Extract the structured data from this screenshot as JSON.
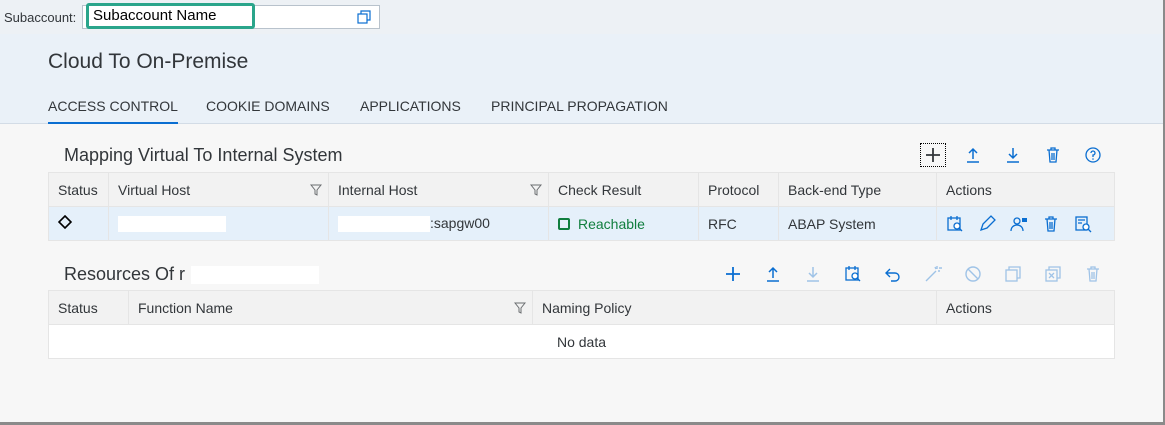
{
  "subaccount": {
    "label": "Subaccount:",
    "value": "Subaccount Name",
    "popout_icon": "popout-icon"
  },
  "page": {
    "title": "Cloud To On-Premise"
  },
  "tabs": [
    {
      "label": "ACCESS CONTROL",
      "active": true
    },
    {
      "label": "COOKIE DOMAINS",
      "active": false
    },
    {
      "label": "APPLICATIONS",
      "active": false
    },
    {
      "label": "PRINCIPAL PROPAGATION",
      "active": false
    }
  ],
  "mapping": {
    "title": "Mapping Virtual To Internal System",
    "toolbar": [
      "add-icon",
      "upload-icon",
      "download-icon",
      "delete-icon",
      "help-icon"
    ],
    "columns": [
      "Status",
      "Virtual Host",
      "Internal Host",
      "Check Result",
      "Protocol",
      "Back-end Type",
      "Actions"
    ],
    "rows": [
      {
        "status_icon": "diamond-icon",
        "virtual_host": "",
        "internal_host": ":sapgw00",
        "check_result": "Reachable",
        "protocol": "RFC",
        "backend_type": "ABAP System",
        "actions": [
          "check-availability-icon",
          "edit-icon",
          "principal-icon",
          "delete-icon",
          "resources-icon"
        ]
      }
    ]
  },
  "resources": {
    "title": "Resources Of r",
    "toolbar": [
      "add-icon",
      "upload-icon",
      "download-icon",
      "check-icon",
      "undo-icon",
      "wand-icon",
      "block-icon",
      "copy-icon",
      "remove-icon",
      "delete-icon"
    ],
    "columns": [
      "Status",
      "Function Name",
      "Naming Policy",
      "Actions"
    ],
    "empty_text": "No data"
  },
  "colors": {
    "accent": "#0a6ed1",
    "success": "#107e3e",
    "highlight_border": "#2aa58b"
  }
}
